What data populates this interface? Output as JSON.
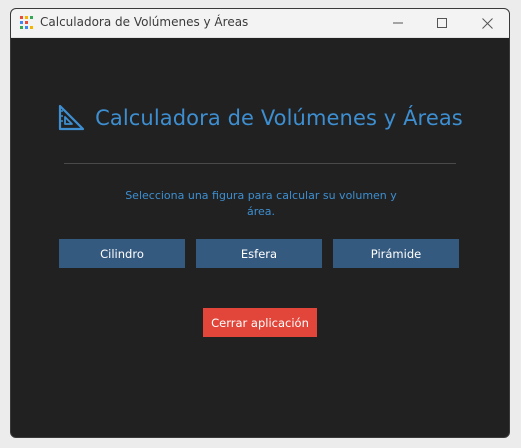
{
  "window": {
    "title": "Calculadora de Volúmenes y Áreas",
    "app_icon": "app-icon",
    "controls": {
      "minimize_icon": "minimize-icon",
      "maximize_icon": "maximize-icon",
      "close_icon": "close-icon"
    }
  },
  "main": {
    "heading_icon": "set-square-icon",
    "heading": "Calculadora de Volúmenes y Áreas",
    "subtitle": "Selecciona una figura para calcular su volumen y área.",
    "shape_buttons": [
      {
        "label": "Cilindro"
      },
      {
        "label": "Esfera"
      },
      {
        "label": "Pirámide"
      }
    ],
    "exit_button": {
      "label": "Cerrar aplicación"
    }
  },
  "colors": {
    "background": "#212121",
    "accent_text": "#3d8fd1",
    "shape_button_bg": "#355a80",
    "exit_button_bg": "#e2463a",
    "titlebar_bg": "#f3f3f3"
  }
}
